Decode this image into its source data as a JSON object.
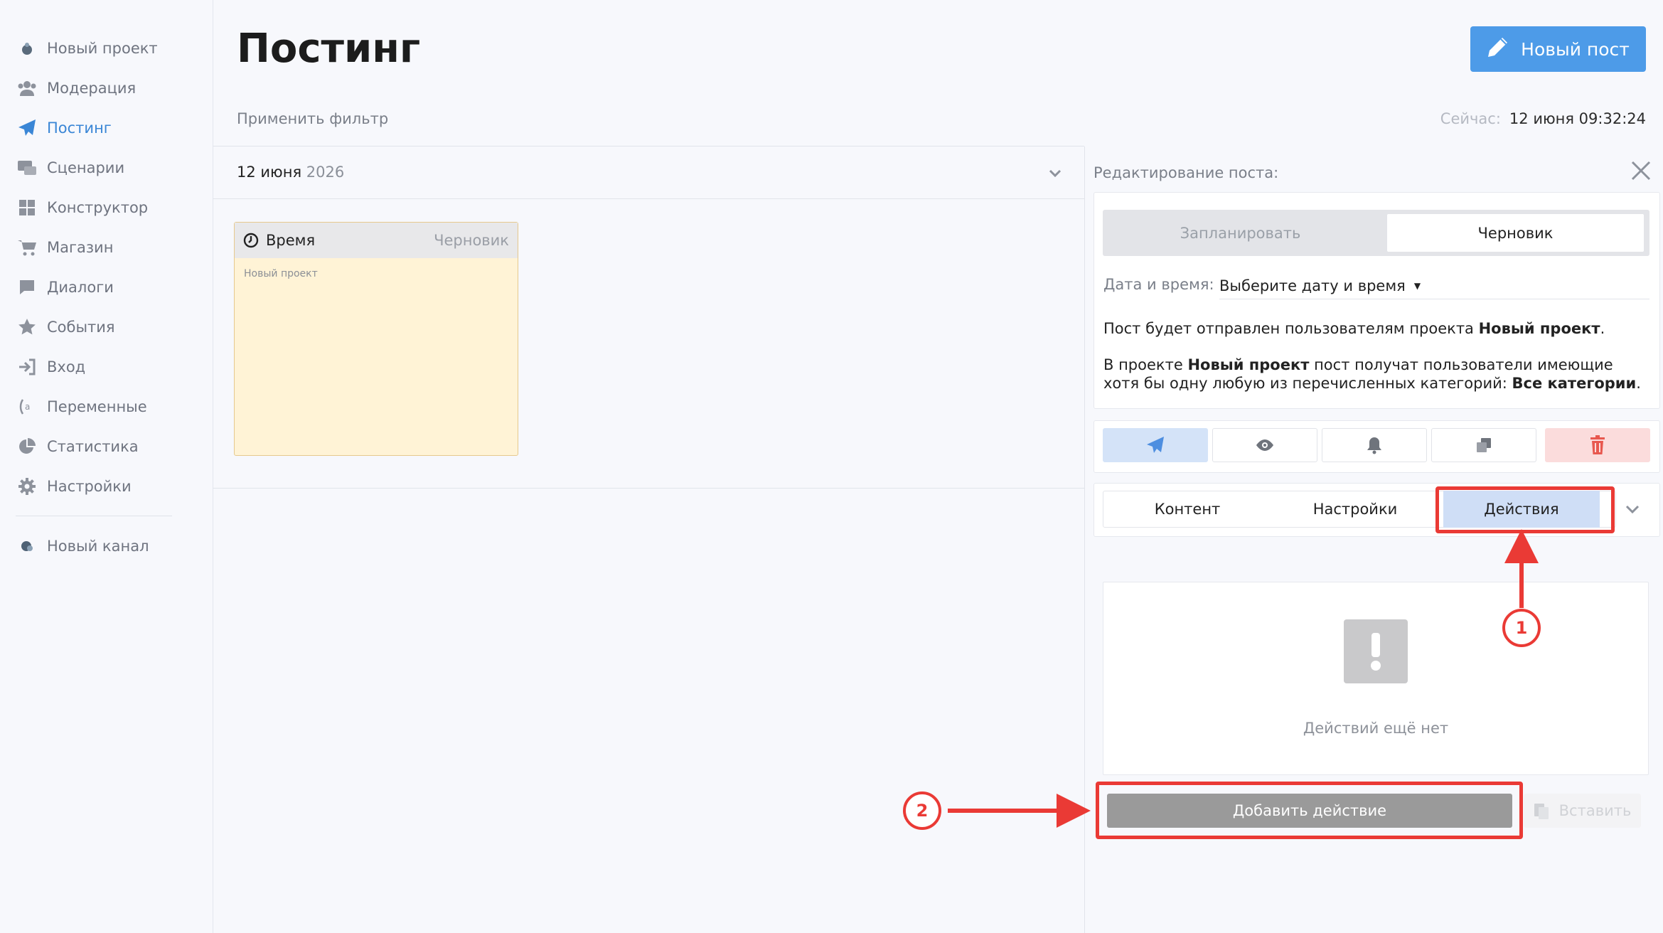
{
  "sidebar": {
    "items": [
      {
        "label": "Новый проект",
        "icon": "project-avatar-icon",
        "active": false
      },
      {
        "label": "Модерация",
        "icon": "users-icon",
        "active": false
      },
      {
        "label": "Постинг",
        "icon": "paper-plane-icon",
        "active": true
      },
      {
        "label": "Сценарии",
        "icon": "scenarios-icon",
        "active": false
      },
      {
        "label": "Конструктор",
        "icon": "grid-icon",
        "active": false
      },
      {
        "label": "Магазин",
        "icon": "cart-icon",
        "active": false
      },
      {
        "label": "Диалоги",
        "icon": "chat-bubble-icon",
        "active": false
      },
      {
        "label": "События",
        "icon": "star-icon",
        "active": false
      },
      {
        "label": "Вход",
        "icon": "sign-in-icon",
        "active": false
      },
      {
        "label": "Переменные",
        "icon": "variables-icon",
        "active": false
      },
      {
        "label": "Статистика",
        "icon": "pie-chart-icon",
        "active": false
      },
      {
        "label": "Настройки",
        "icon": "gear-icon",
        "active": false
      }
    ],
    "channel": {
      "label": "Новый канал",
      "icon": "channel-avatar-icon"
    }
  },
  "header": {
    "title": "Постинг",
    "new_post_label": "Новый пост",
    "filter_label": "Применить фильтр",
    "now_label": "Сейчас:",
    "now_value": "12 июня 09:32:24"
  },
  "date_group": {
    "day": "12 июня",
    "year": "2026"
  },
  "post_card": {
    "time_label": "Время",
    "status": "Черновик",
    "project": "Новый проект"
  },
  "edit_panel": {
    "title": "Редактирование поста:",
    "toggle": {
      "schedule": "Запланировать",
      "draft": "Черновик",
      "selected": "draft"
    },
    "datetime_label": "Дата и время:",
    "datetime_placeholder": "Выберите дату и время",
    "info1": {
      "pre": "Пост будет отправлен пользователям проекта ",
      "project": "Новый проект",
      "post": "."
    },
    "info2": {
      "pre": "В проекте ",
      "project": "Новый проект",
      "mid": " пост получат пользователи имеющие хотя бы одну любую из перечисленных категорий: ",
      "categories": "Все категории",
      "post": "."
    },
    "tabs": [
      {
        "label": "Контент",
        "active": false
      },
      {
        "label": "Настройки",
        "active": false
      },
      {
        "label": "Действия",
        "active": true
      }
    ],
    "empty_text": "Действий ещё нет",
    "add_action_label": "Добавить действие",
    "paste_label": "Вставить"
  },
  "annotations": {
    "badge1": "1",
    "badge2": "2"
  },
  "colors": {
    "accent": "#4d9be8",
    "active_nav": "#3a86d6",
    "annotation": "#ea3a35",
    "card_bg": "#fff3d6"
  }
}
